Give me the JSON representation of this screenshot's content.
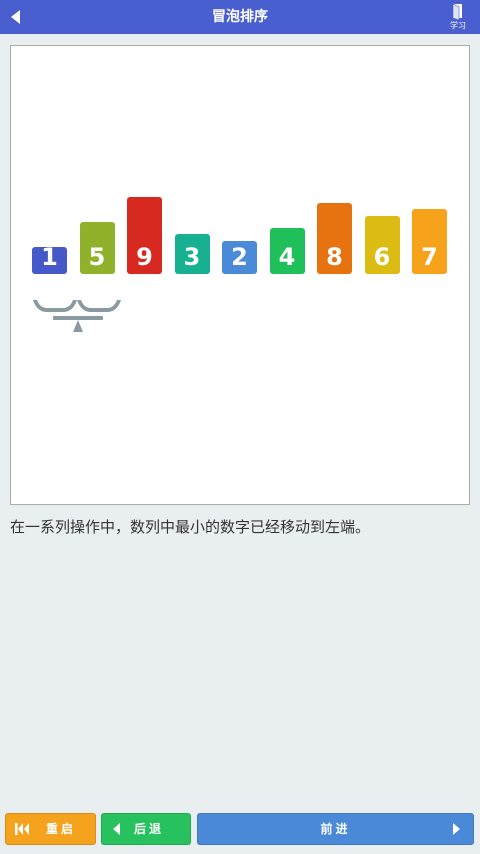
{
  "header": {
    "title": "冒泡排序",
    "learn_label": "学习"
  },
  "visualization": {
    "bars": [
      {
        "value": "1",
        "color": "#4559c9"
      },
      {
        "value": "5",
        "color": "#8fb22a"
      },
      {
        "value": "9",
        "color": "#d7291f"
      },
      {
        "value": "3",
        "color": "#17b191"
      },
      {
        "value": "2",
        "color": "#4a8ad9"
      },
      {
        "value": "4",
        "color": "#1fbf5a"
      },
      {
        "value": "8",
        "color": "#e6730f"
      },
      {
        "value": "6",
        "color": "#dcbc13"
      },
      {
        "value": "7",
        "color": "#f6a21b"
      }
    ],
    "scale_icon": "balance-scale-icon",
    "scale_color": "#8a9aa1"
  },
  "description": "在一系列操作中，数列中最小的数字已经移动到左端。",
  "controls": {
    "restart_label": "重启",
    "back_label": "后退",
    "forward_label": "前进"
  },
  "colors": {
    "header_bg": "#4a5fcf",
    "restart": "#f5a21c",
    "back": "#27c25d",
    "forward": "#4a88d8"
  }
}
